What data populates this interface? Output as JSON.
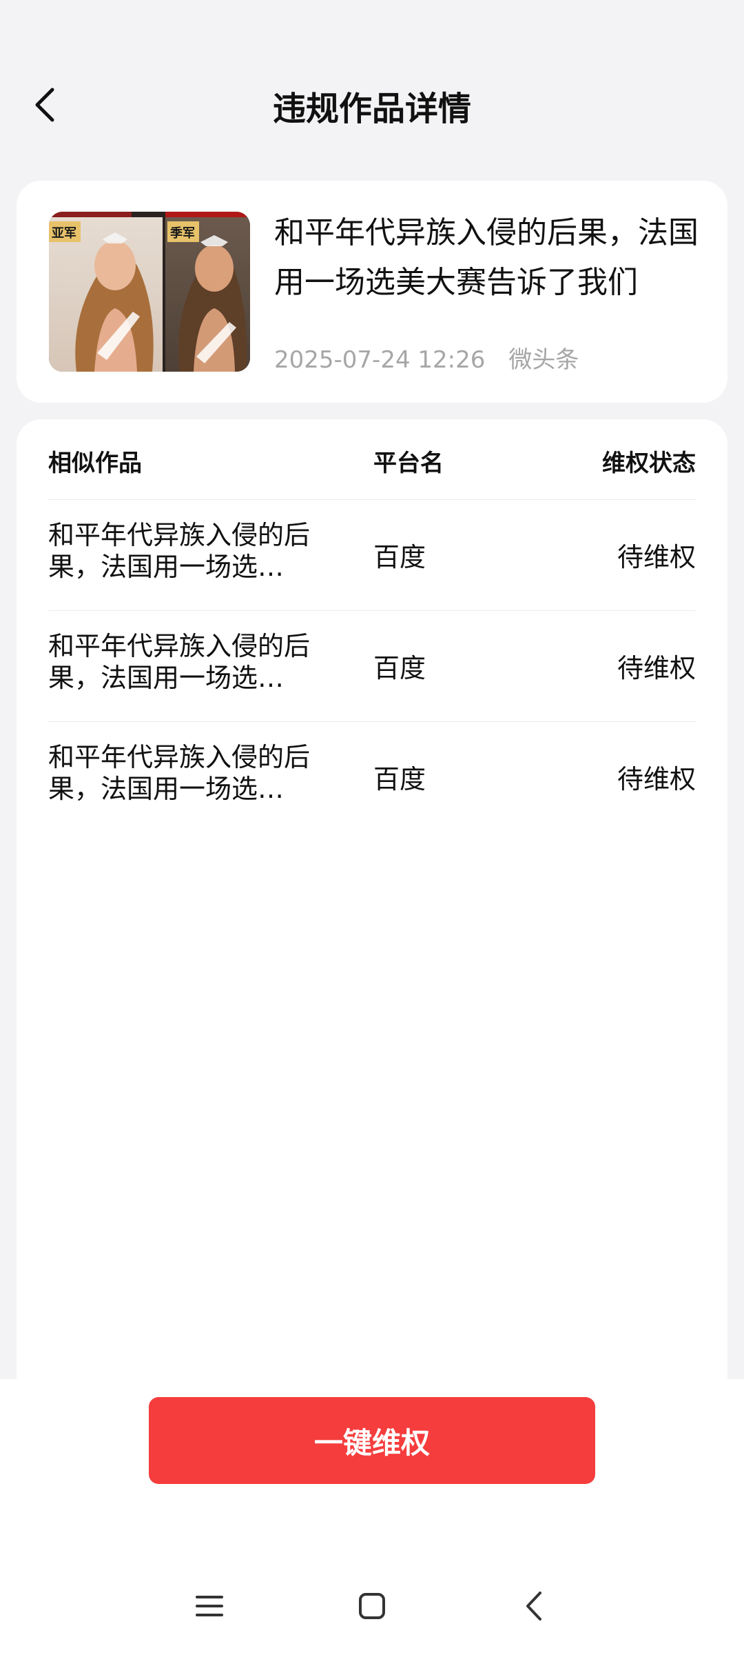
{
  "header": {
    "title": "违规作品详情"
  },
  "work": {
    "title": "和平年代异族入侵的后果，法国用一场选美大赛告诉了我们",
    "date": "2025-07-24 12:26",
    "platform": "微头条",
    "thumb_labels": [
      "亚军",
      "季军"
    ]
  },
  "table": {
    "headers": {
      "similar": "相似作品",
      "platform": "平台名",
      "status": "维权状态"
    },
    "rows": [
      {
        "title": "和平年代异族入侵的后果，法国用一场选美大赛告诉了我们",
        "platform": "百度",
        "status": "待维权"
      },
      {
        "title": "和平年代异族入侵的后果，法国用一场选美大赛告诉了我们",
        "platform": "百度",
        "status": "待维权"
      },
      {
        "title": "和平年代异族入侵的后果，法国用一场选美大赛告诉了我们",
        "platform": "百度",
        "status": "待维权"
      }
    ]
  },
  "actions": {
    "primary_label": "一键维权"
  },
  "nav": {
    "icons": [
      "menu-icon",
      "home-icon",
      "back-icon"
    ]
  },
  "colors": {
    "accent": "#f53d3d",
    "background": "#f3f3f5",
    "muted_text": "#a6a6a6"
  }
}
